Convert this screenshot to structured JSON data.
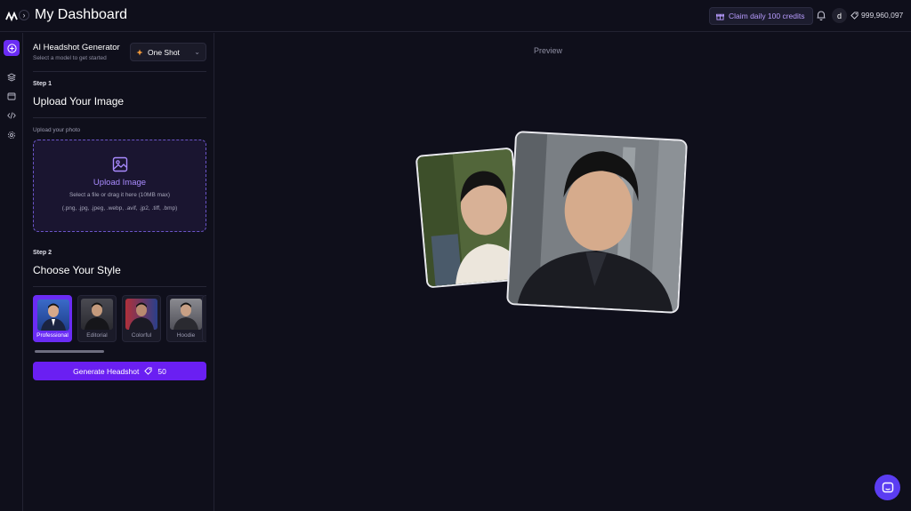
{
  "header": {
    "title": "My Dashboard",
    "claim_label": "Claim daily 100 credits",
    "avatar_initial": "d",
    "credits": "999,960,097"
  },
  "model": {
    "title": "AI Headshot Generator",
    "subtitle": "Select a model to get started",
    "selected": "One Shot"
  },
  "step1": {
    "step": "Step 1",
    "title": "Upload Your Image",
    "field_label": "Upload your photo",
    "upload_title": "Upload Image",
    "upload_hint": "Select a file or drag it here (10MB max)",
    "upload_types": "(.png, .jpg, .jpeg, .webp, .avif, .jp2, .tiff, .bmp)"
  },
  "step2": {
    "step": "Step 2",
    "title": "Choose Your Style",
    "styles": [
      {
        "label": "Professional",
        "selected": true
      },
      {
        "label": "Editorial",
        "selected": false
      },
      {
        "label": "Colorful",
        "selected": false
      },
      {
        "label": "Hoodie",
        "selected": false
      }
    ]
  },
  "generate": {
    "label": "Generate Headshot",
    "cost": "50"
  },
  "preview": {
    "label": "Preview"
  },
  "colors": {
    "accent": "#6a2cf5",
    "background": "#0f0f1b",
    "highlight_text": "#a98bff"
  }
}
